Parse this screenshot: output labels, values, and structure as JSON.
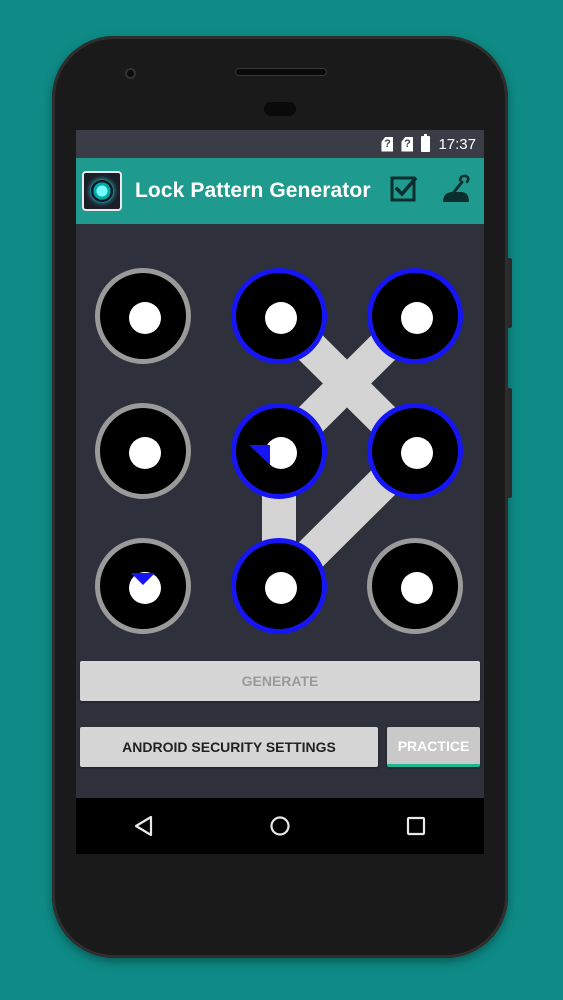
{
  "status_bar": {
    "sim1_label": "?",
    "sim2_label": "?",
    "time": "17:37"
  },
  "app_bar": {
    "title": "Lock Pattern Generator",
    "logo_icon": "lock-logo-icon",
    "actions": [
      {
        "icon": "checkbox-checked-icon"
      },
      {
        "icon": "lock-pattern-icon"
      }
    ],
    "background_color": "#1f9a8f"
  },
  "pattern": {
    "columns": 3,
    "rows": 3,
    "selected_sequence": [
      2,
      4,
      7,
      5,
      1
    ],
    "active_ring_color": "#1616f5",
    "inactive_ring_color": "#9a9a9a",
    "link_color": "#d4d4d4"
  },
  "buttons": {
    "generate_label": "GENERATE",
    "security_settings_label": "ANDROID SECURITY SETTINGS",
    "practice_label": "PRACTICE"
  },
  "nav_bar": {
    "back_icon": "back-triangle-icon",
    "home_icon": "home-circle-icon",
    "recents_icon": "recents-square-icon"
  }
}
